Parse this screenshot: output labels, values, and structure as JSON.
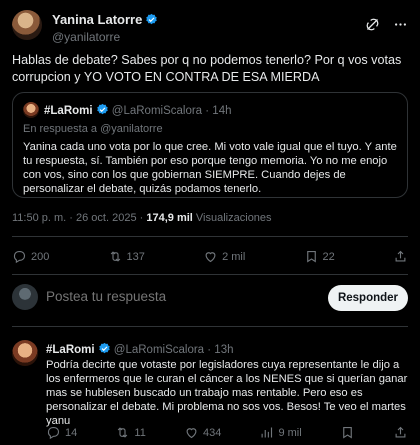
{
  "main_tweet": {
    "author_name": "Yanina Latorre",
    "author_handle": "@yanilatorre",
    "text": "Hablas de debate? Sabes por q no podemos tenerlo? Por q vos votas corrupcion y YO VOTO EN CONTRA DE ESA MIERDA",
    "time": "11:50 p. m.",
    "separator": "·",
    "date": "26 oct. 2025",
    "views_count": "174,9 mil",
    "views_label": "Visualizaciones",
    "stats": {
      "replies": "200",
      "reposts": "137",
      "likes": "2 mil",
      "bookmarks": "22"
    }
  },
  "quoted_tweet": {
    "author_name": "#LaRomi",
    "author_handle": "@LaRomiScalora",
    "age": "· 14h",
    "reply_prefix": "En respuesta a",
    "reply_to": "@yanilatorre",
    "text": "Yanina cada uno vota por lo que cree. Mi voto vale igual que el tuyo. Y ante tu respuesta, sí. También por eso porque tengo memoria. Yo no me enojo con vos, sino con los que gobiernan SIEMPRE. Cuando dejes de personalizar el debate, quizás podamos tenerlo."
  },
  "composer": {
    "placeholder": "Postea tu respuesta",
    "button_label": "Responder"
  },
  "reply_tweet": {
    "author_name": "#LaRomi",
    "author_handle": "@LaRomiScalora",
    "age": "· 13h",
    "text": "Podría decirte que votaste por legisladores cuya representante le dijo a los enfermeros que le curan el cáncer a los NENES que si querían ganar mas se hublesen buscado un trabajo mas rentable. Pero eso es personalizar el debate. Mi problema no sos vos. Besos! Te veo el martes yanu",
    "stats": {
      "replies": "14",
      "reposts": "11",
      "likes": "434",
      "views": "9 mil"
    }
  },
  "icons": {
    "verified": "verified-badge-icon",
    "grok": "grok-icon",
    "more": "more-icon",
    "reply": "reply-icon",
    "repost": "repost-icon",
    "like": "heart-icon",
    "bookmark": "bookmark-icon",
    "share": "share-icon",
    "views": "views-icon"
  },
  "colors": {
    "background": "#000000",
    "text": "#e7e9ea",
    "muted": "#71767b",
    "accent": "#1d9bf0",
    "border": "#2f3336"
  }
}
